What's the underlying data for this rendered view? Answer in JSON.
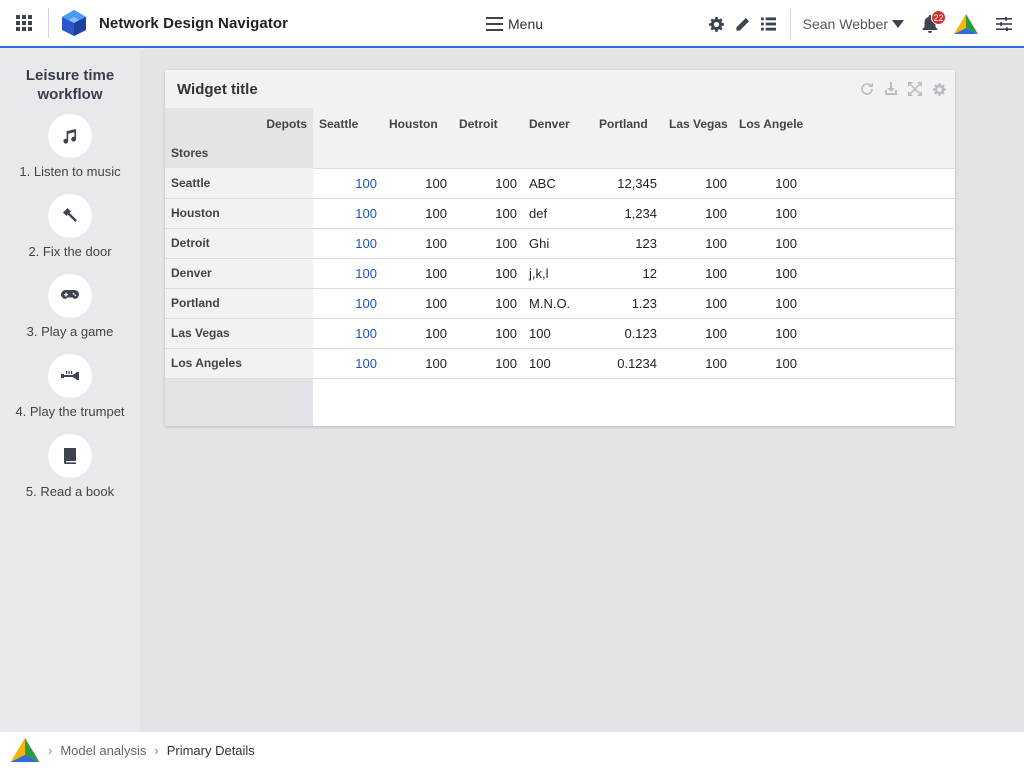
{
  "header": {
    "app_title": "Network Design Navigator",
    "menu_label": "Menu",
    "user_name": "Sean Webber",
    "notification_count": "22"
  },
  "sidebar": {
    "title": "Leisure time workflow",
    "steps": [
      {
        "label": "1. Listen to music",
        "icon": "music-icon"
      },
      {
        "label": "2. Fix the door",
        "icon": "hammer-icon"
      },
      {
        "label": "3. Play a game",
        "icon": "gamepad-icon"
      },
      {
        "label": "4. Play the trumpet",
        "icon": "trumpet-icon"
      },
      {
        "label": "5. Read a book",
        "icon": "book-icon"
      }
    ]
  },
  "widget": {
    "title": "Widget title",
    "corner_top": "Depots",
    "corner_bottom": "Stores",
    "columns": [
      "Seattle",
      "Houston",
      "Detroit",
      "Denver",
      "Portland",
      "Las Vegas",
      "Los Angeles"
    ],
    "rows": [
      {
        "label": "Seattle",
        "cells": [
          "100",
          "100",
          "100",
          "ABC",
          "12,345",
          "100",
          "100"
        ]
      },
      {
        "label": "Houston",
        "cells": [
          "100",
          "100",
          "100",
          "def",
          "1,234",
          "100",
          "100"
        ]
      },
      {
        "label": "Detroit",
        "cells": [
          "100",
          "100",
          "100",
          "Ghi",
          "123",
          "100",
          "100"
        ]
      },
      {
        "label": "Denver",
        "cells": [
          "100",
          "100",
          "100",
          "j,k,l",
          "12",
          "100",
          "100"
        ]
      },
      {
        "label": "Portland",
        "cells": [
          "100",
          "100",
          "100",
          "M.N.O.",
          "1.23",
          "100",
          "100"
        ]
      },
      {
        "label": "Las Vegas",
        "cells": [
          "100",
          "100",
          "100",
          "100",
          "0.123",
          "100",
          "100"
        ]
      },
      {
        "label": "Los Angeles",
        "cells": [
          "100",
          "100",
          "100",
          "100",
          "0.1234",
          "100",
          "100"
        ]
      }
    ]
  },
  "breadcrumb": {
    "items": [
      "Model analysis",
      "Primary Details"
    ]
  },
  "colors": {
    "accent": "#2e6ed6",
    "link": "#1a56c5",
    "badge": "#d32f2f"
  }
}
